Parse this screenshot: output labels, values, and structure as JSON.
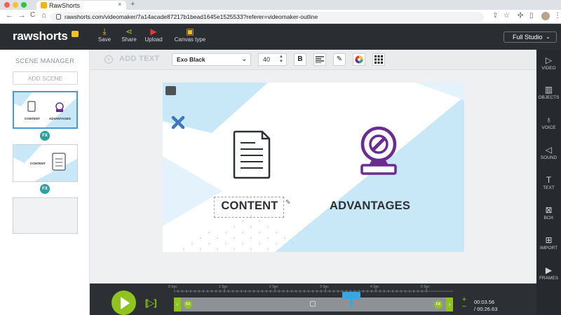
{
  "browser": {
    "tab_title": "RawShorts",
    "tab_close": "×",
    "new_tab": "+",
    "url": "rawshorts.com/videomaker/7a14acade87217b1bead1645e1525533?referer=videomaker-outline",
    "back": "←",
    "forward": "→",
    "reload": "C",
    "home": "⌂"
  },
  "app": {
    "logo": "rawshorts",
    "header_buttons": [
      {
        "label": "Save",
        "icon": "download-icon",
        "glyph": "⤓"
      },
      {
        "label": "Share",
        "icon": "share-icon",
        "glyph": "⋖"
      },
      {
        "label": "Upload",
        "icon": "youtube-icon",
        "glyph": "▶"
      },
      {
        "label": "Canvas type",
        "icon": "canvas-icon",
        "glyph": "▣"
      }
    ],
    "mode_select": "Full Studio",
    "mode_chevron": "⌄"
  },
  "scene_manager": {
    "title": "SCENE MANAGER",
    "add_scene": "ADD SCENE",
    "fx_label": "FX",
    "scenes": [
      {
        "left_label": "CONTENT",
        "right_label": "ADVANTAGES"
      },
      {
        "left_label": "CONTENT"
      },
      {}
    ]
  },
  "toolbar": {
    "add_text": "ADD TEXT",
    "add_icon": "+",
    "font": "Exo Black",
    "font_size": "40",
    "bold": "B",
    "font_chevron": "⌄"
  },
  "canvas": {
    "left_label": "CONTENT",
    "right_label": "ADVANTAGES",
    "colors": {
      "accent_blue": "#3d78b8",
      "purple": "#6a2c91",
      "light_blue": "#c8e7f7",
      "dark_text": "#2c2f33"
    }
  },
  "right_sidebar": [
    {
      "label": "VIDEO",
      "icon": "video-icon",
      "glyph": "▷"
    },
    {
      "label": "OBJECTS",
      "icon": "objects-icon",
      "glyph": "▥"
    },
    {
      "label": "VOICE",
      "icon": "microphone-icon",
      "glyph": "♁"
    },
    {
      "label": "SOUND",
      "icon": "speaker-icon",
      "glyph": "◁"
    },
    {
      "label": "TEXT",
      "icon": "text-icon",
      "glyph": "T"
    },
    {
      "label": "BOX",
      "icon": "box-icon",
      "glyph": "⊠"
    },
    {
      "label": "IMPORT",
      "icon": "import-icon",
      "glyph": "⊞"
    },
    {
      "label": "FRAMES",
      "icon": "frames-icon",
      "glyph": "▶"
    }
  ],
  "timeline": {
    "ticks": [
      "0 Sec",
      "1 Sec",
      "2 Sec",
      "3 Sec",
      "4 Sec",
      "5 Sec"
    ],
    "current_time": "00:03.56",
    "total_time": "/ 00:26.63",
    "fx_label": "FX",
    "zoom_in": "+",
    "zoom_out": "−",
    "step_icon": "[▷]",
    "left_arrow": "‹",
    "right_arrow": "›"
  }
}
